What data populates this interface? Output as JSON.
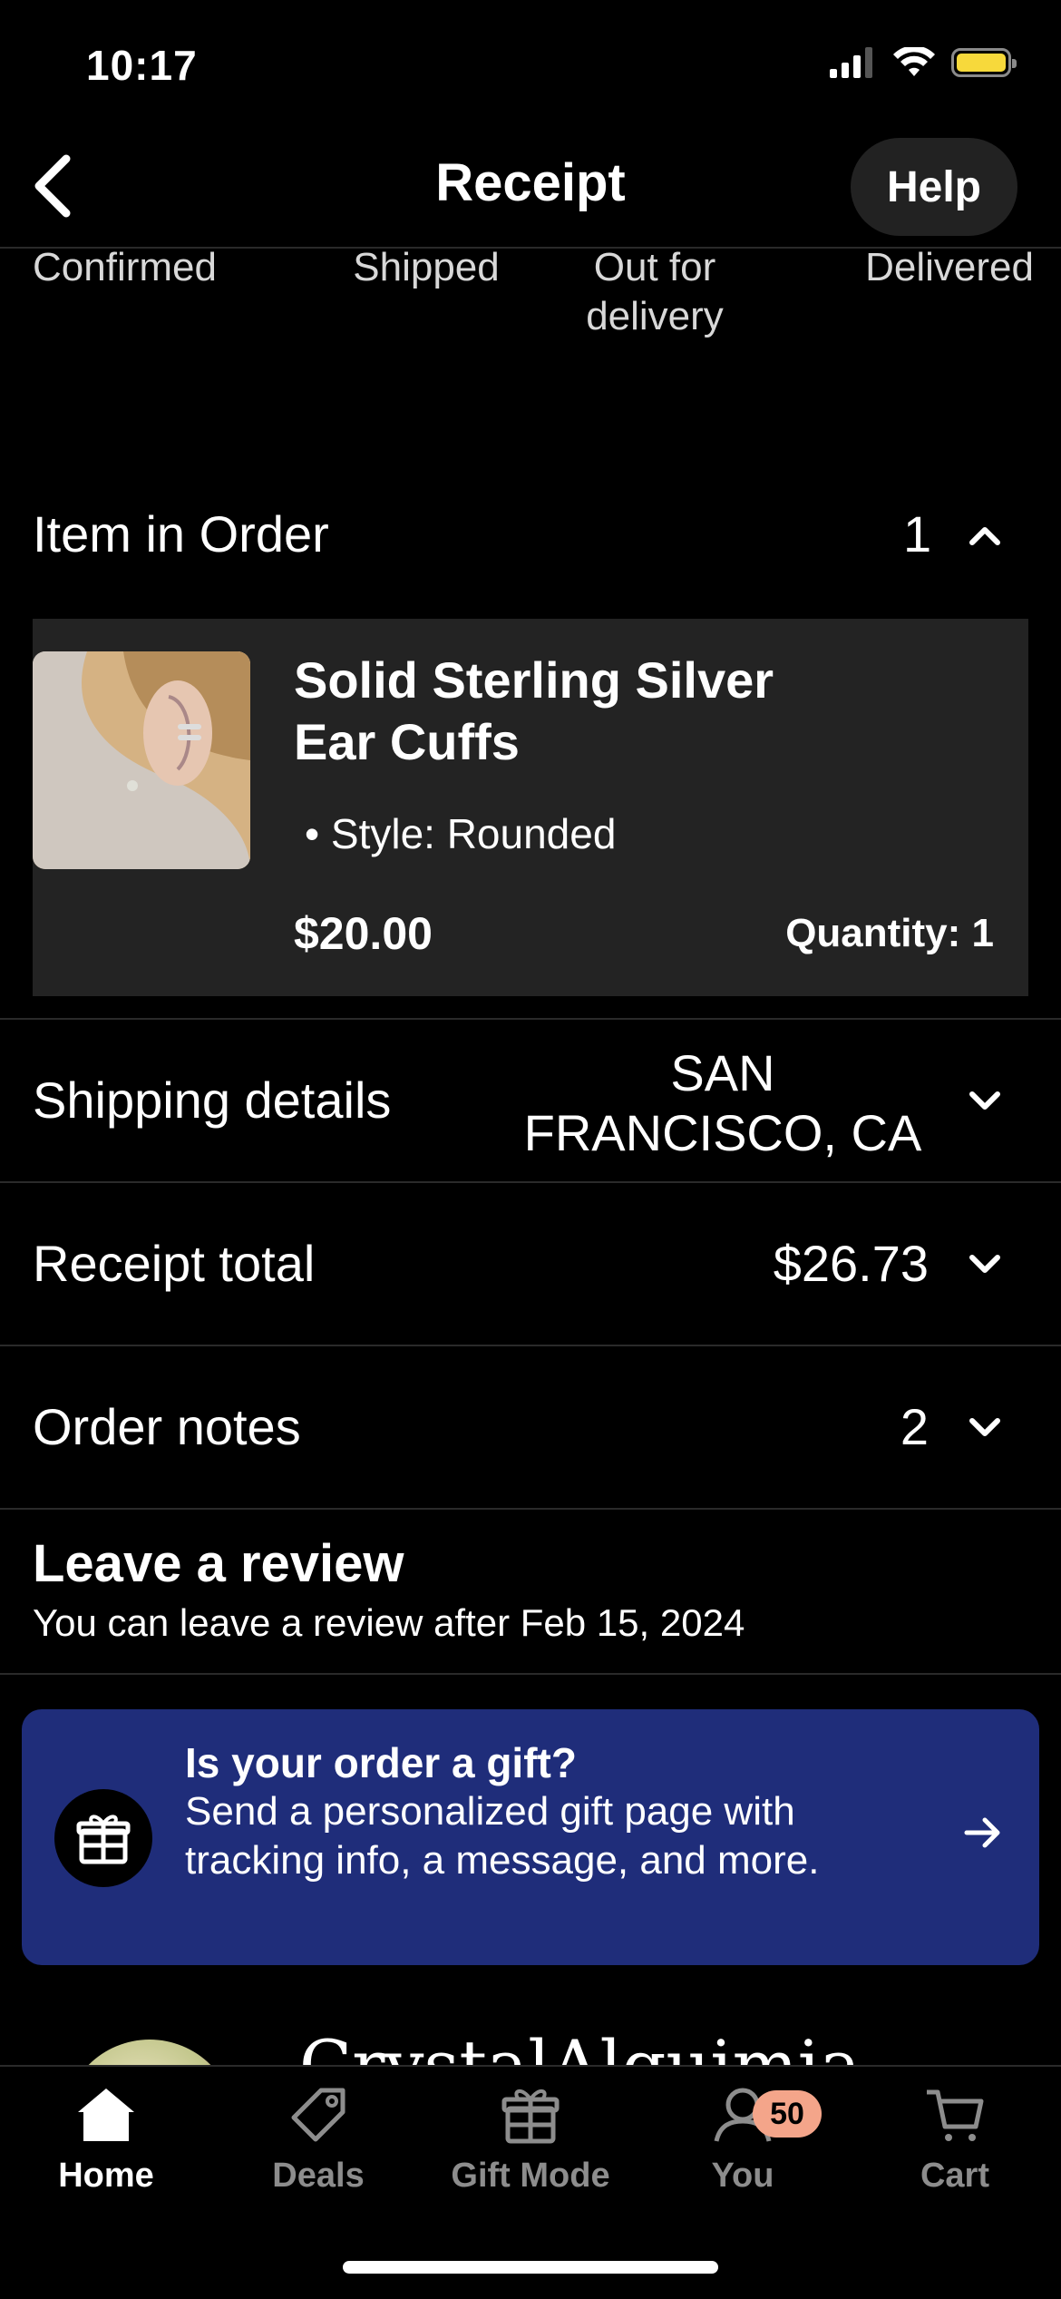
{
  "status_bar": {
    "time": "10:17"
  },
  "header": {
    "title": "Receipt",
    "help_label": "Help"
  },
  "progress_steps": [
    "Confirmed",
    "Shipped",
    "Out for delivery",
    "Delivered"
  ],
  "items_section": {
    "title": "Item in Order",
    "count": "1"
  },
  "item": {
    "name": "Solid Sterling Silver Ear Cuffs",
    "style": "Style: Rounded",
    "price": "$20.00",
    "quantity": "Quantity: 1"
  },
  "shipping": {
    "label": "Shipping details",
    "value": "SAN FRANCISCO, CA"
  },
  "receipt_total": {
    "label": "Receipt total",
    "value": "$26.73"
  },
  "order_notes": {
    "label": "Order notes",
    "count": "2"
  },
  "review": {
    "title": "Leave a review",
    "subtitle": "You can leave a review after Feb 15, 2024"
  },
  "gift_banner": {
    "title": "Is your order a gift?",
    "body": "Send a personalized gift page with tracking info, a message, and more."
  },
  "shop_peek": {
    "name": "CrystalAlquimia"
  },
  "tab_bar": {
    "home": "Home",
    "deals": "Deals",
    "gift_mode": "Gift Mode",
    "you": "You",
    "you_badge": "50",
    "cart": "Cart"
  },
  "colors": {
    "gift_banner_bg": "#1f2d7a",
    "battery": "#f7d93b",
    "badge": "#f4a58a"
  }
}
